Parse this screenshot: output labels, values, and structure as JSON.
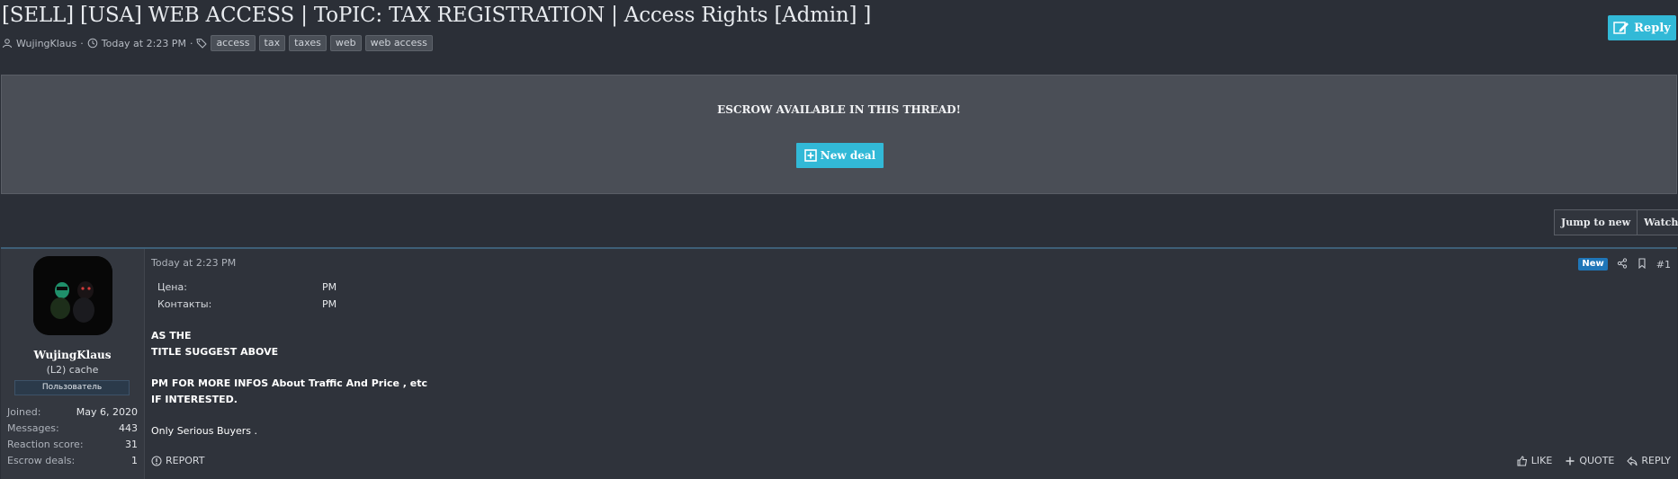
{
  "thread": {
    "title": "[SELL] [USA] WEB ACCESS | ToPIC: TAX REGISTRATION | Access Rights [Admin] ]",
    "author": "WujingKlaus",
    "separator": "·",
    "date": "Today at 2:23 PM",
    "tags": [
      "access",
      "tax",
      "taxes",
      "web",
      "web access"
    ],
    "reply_label": "Reply"
  },
  "escrow": {
    "title": "ESCROW AVAILABLE IN THIS THREAD!",
    "new_deal_label": "New deal"
  },
  "controls": {
    "jump_label": "Jump to new",
    "watch_label": "Watch"
  },
  "post": {
    "user": {
      "name": "WujingKlaus",
      "title": "(L2) cache",
      "badge": "Пользователь",
      "stats": [
        {
          "label": "Joined:",
          "value": "May 6, 2020"
        },
        {
          "label": "Messages:",
          "value": "443"
        },
        {
          "label": "Reaction score:",
          "value": "31"
        },
        {
          "label": "Escrow deals:",
          "value": "1"
        }
      ]
    },
    "date": "Today at 2:23 PM",
    "new_badge": "New",
    "number": "#1",
    "fields": [
      {
        "label": "Цена:",
        "value": "PM"
      },
      {
        "label": "Контакты:",
        "value": "PM"
      }
    ],
    "body": {
      "line1": "AS THE",
      "line2": "TITLE SUGGEST ABOVE",
      "line3": "PM FOR MORE INFOS About Traffic And Price , etc",
      "line4": "IF INTERESTED.",
      "line5": "Only Serious Buyers ."
    },
    "footer": {
      "report": "REPORT",
      "like": "LIKE",
      "quote": "QUOTE",
      "reply": "REPLY"
    }
  },
  "colors": {
    "accent": "#32b9d7",
    "background": "#2b2f37",
    "panel": "#4a4e56",
    "new_badge": "#1f76b8"
  }
}
